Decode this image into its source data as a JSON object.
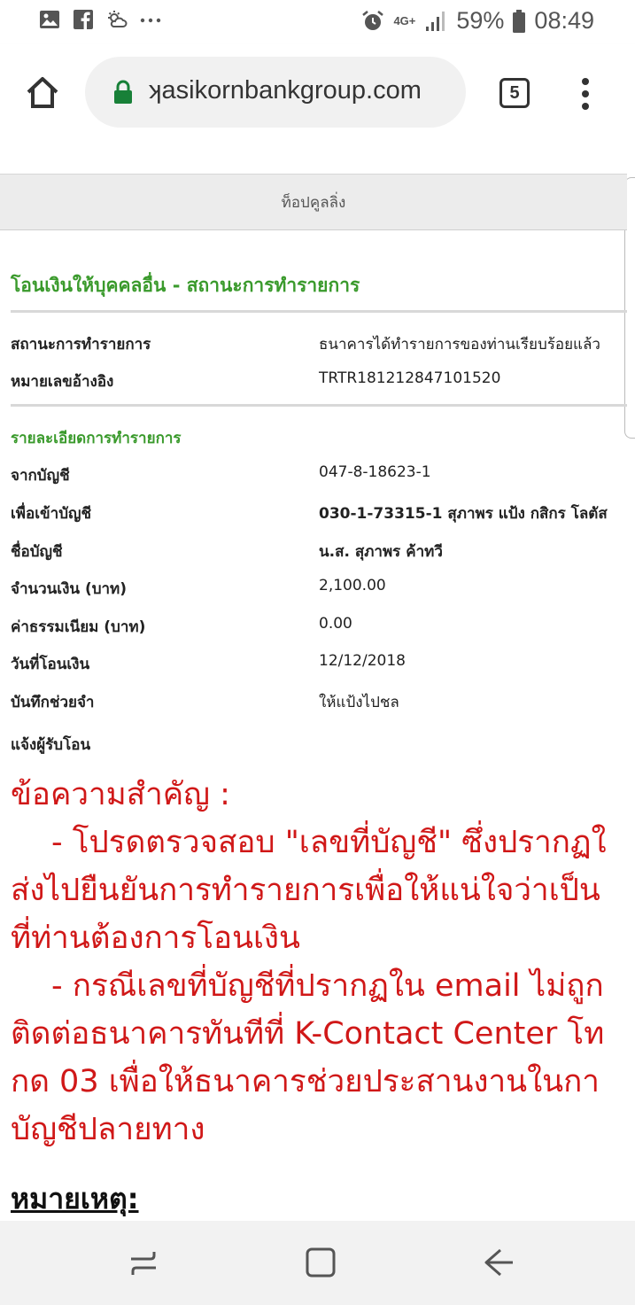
{
  "status_bar": {
    "left_icons": [
      "gallery-icon",
      "facebook-icon",
      "weather-icon",
      "more-dots-icon"
    ],
    "network": "4G+",
    "battery": "59%",
    "time": "08:49"
  },
  "browser": {
    "url": "ʞasikornbankgroup.com",
    "tab_count": "5"
  },
  "page": {
    "top_bar": "ท็อปคูลลิ่ง",
    "title": "โอนเงินให้บุคคลอื่น - สถานะการทำรายการ",
    "summary": [
      {
        "label": "สถานะการทำรายการ",
        "value": "ธนาคารได้ทำรายการของท่านเรียบร้อยแล้ว"
      },
      {
        "label": "หมายเลขอ้างอิง",
        "value": "TRTR181212847101520"
      }
    ],
    "details_heading": "รายละเอียดการทำรายการ",
    "details": [
      {
        "label": "จากบัญชี",
        "value": "047-8-18623-1"
      },
      {
        "label": "เพื่อเข้าบัญชี",
        "value": "030-1-73315-1 สุภาพร แป้ง กสิกร โลตัส"
      },
      {
        "label": "ชื่อบัญชี",
        "value": "น.ส. สุภาพร ค้าทวี"
      },
      {
        "label": "จำนวนเงิน (บาท)",
        "value": "2,100.00"
      },
      {
        "label": "ค่าธรรมเนียม (บาท)",
        "value": "0.00"
      },
      {
        "label": "วันที่โอนเงิน",
        "value": "12/12/2018"
      },
      {
        "label": "บันทึกช่วยจำ",
        "value": "ให้แป้งไปชล"
      },
      {
        "label": "แจ้งผู้รับโอน",
        "value": ""
      }
    ],
    "notice_lines": [
      "ข้อความสำคัญ :",
      "- โปรดตรวจสอบ \"เลขที่บัญชี\" ซึ่งปรากฏใ",
      "ส่งไปยืนยันการทำรายการเพื่อให้แน่ใจว่าเป็น",
      "ที่ท่านต้องการโอนเงิน",
      "- กรณีเลขที่บัญชีที่ปรากฏใน email ไม่ถูก",
      "ติดต่อธนาคารทันทีที่ K-Contact Center โท",
      "กด 03 เพื่อให้ธนาคารช่วยประสานงานในกา",
      "บัญชีปลายทาง"
    ],
    "remark": "หมายเหตุ:"
  },
  "colors": {
    "accent_green": "#3a9a2c",
    "notice_red": "#d01818"
  }
}
